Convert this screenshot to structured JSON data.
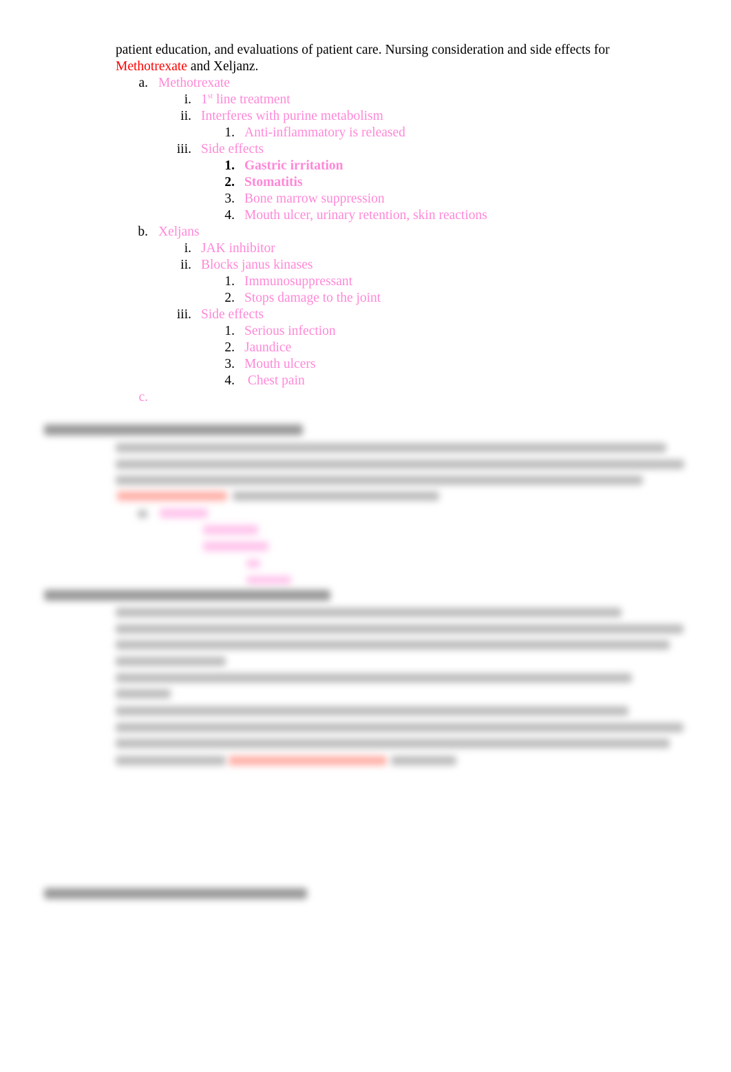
{
  "intro": {
    "line1": "patient education, and evaluations of patient care. Nursing consideration and side effects for",
    "drug_red": "Methotrexate",
    "line2_rest": " and Xeljanz."
  },
  "list": [
    {
      "level": 1,
      "marker": "a.",
      "text": "Methotrexate"
    },
    {
      "level": 2,
      "marker": "i.",
      "text": "1",
      "sup": "st",
      "text_after": " line treatment"
    },
    {
      "level": 2,
      "marker": "ii.",
      "text": "Interferes with purine metabolism"
    },
    {
      "level": 3,
      "marker": "1.",
      "text": "Anti-inflammatory is released"
    },
    {
      "level": 2,
      "marker": "iii.",
      "text": "Side effects"
    },
    {
      "level": 3,
      "marker": "1.",
      "text": "Gastric irritation",
      "bold": true
    },
    {
      "level": 3,
      "marker": "2.",
      "text": "Stomatitis",
      "bold": true
    },
    {
      "level": 3,
      "marker": "3.",
      "text": "Bone marrow suppression"
    },
    {
      "level": 3,
      "marker": "4.",
      "text": "Mouth ulcer, urinary retention, skin reactions"
    },
    {
      "level": 1,
      "marker": "b.",
      "text": "Xeljans"
    },
    {
      "level": 2,
      "marker": "i.",
      "text": "JAK inhibitor"
    },
    {
      "level": 2,
      "marker": "ii.",
      "text": "Blocks janus kinases"
    },
    {
      "level": 3,
      "marker": "1.",
      "text": "Immunosuppressant"
    },
    {
      "level": 3,
      "marker": "2.",
      "text": "Stops damage to the joint"
    },
    {
      "level": 2,
      "marker": "iii.",
      "text": "Side effects"
    },
    {
      "level": 3,
      "marker": "1.",
      "text": "Serious infection"
    },
    {
      "level": 3,
      "marker": "2.",
      "text": "Jaundice"
    },
    {
      "level": 3,
      "marker": "3.",
      "text": "Mouth ulcers"
    },
    {
      "level": 3,
      "marker": "4.",
      "text": " Chest pain"
    },
    {
      "level": 1,
      "marker": "c.",
      "text": "",
      "marker_pink": true
    }
  ],
  "colors": {
    "pink": "#ff88d8",
    "red": "#ff0000"
  }
}
